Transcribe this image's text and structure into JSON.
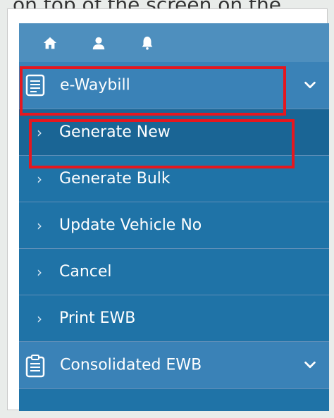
{
  "page_fragment": "on top of the screen on the",
  "topbar": {
    "icons": [
      "home-icon",
      "user-icon",
      "bell-icon"
    ]
  },
  "menu": {
    "eway": {
      "label": "e-Waybill",
      "icon": "document-icon",
      "expanded": true
    },
    "submenu": [
      {
        "label": "Generate New"
      },
      {
        "label": "Generate Bulk"
      },
      {
        "label": "Update Vehicle No"
      },
      {
        "label": "Cancel"
      },
      {
        "label": "Print EWB"
      }
    ],
    "consolidated": {
      "label": "Consolidated EWB",
      "icon": "clipboard-icon"
    }
  },
  "colors": {
    "panel": "#1f73a7",
    "topbar": "#4e8fbe",
    "header": "#3a82b7",
    "highlight": "#e5171f"
  }
}
